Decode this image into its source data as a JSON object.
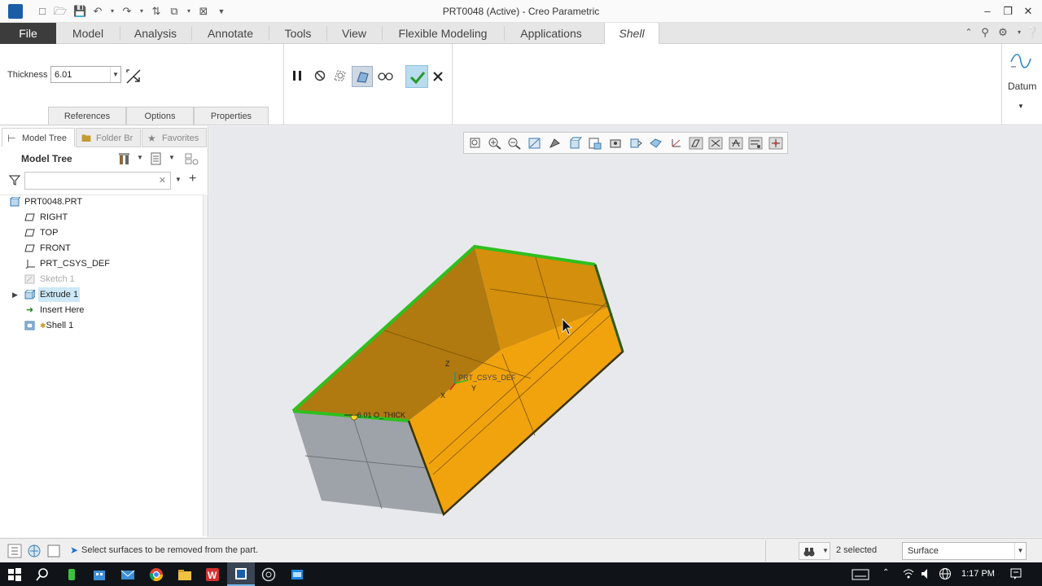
{
  "window": {
    "title": "PRT0048 (Active) - Creo Parametric"
  },
  "ribbon_tabs": [
    "File",
    "Model",
    "Analysis",
    "Annotate",
    "Tools",
    "View",
    "Flexible Modeling",
    "Applications",
    "Shell"
  ],
  "shell_dashboard": {
    "thickness_label": "Thickness",
    "thickness_value": "6.01",
    "subtabs": [
      "References",
      "Options",
      "Properties"
    ],
    "datum_label": "Datum"
  },
  "panel_tabs": [
    "Model Tree",
    "Folder Br",
    "Favorites"
  ],
  "model_tree": {
    "header": "Model Tree",
    "search_placeholder": "",
    "items": [
      {
        "label": "PRT0048.PRT",
        "icon": "part-icon"
      },
      {
        "label": "RIGHT",
        "icon": "datum-plane-icon"
      },
      {
        "label": "TOP",
        "icon": "datum-plane-icon"
      },
      {
        "label": "FRONT",
        "icon": "datum-plane-icon"
      },
      {
        "label": "PRT_CSYS_DEF",
        "icon": "coordinate-system-icon"
      },
      {
        "label": "Sketch 1",
        "icon": "sketch-icon"
      },
      {
        "label": "Extrude 1",
        "icon": "extrude-icon"
      },
      {
        "label": "Insert Here",
        "icon": "insert-arrow-icon"
      },
      {
        "label": "Shell 1",
        "icon": "shell-icon"
      }
    ]
  },
  "viewport": {
    "csys_label": "PRT_CSYS_DEF",
    "thickness_dim_label": "6.01 O_THICK",
    "axis_x": "X",
    "axis_y": "Y",
    "axis_z": "Z",
    "colors": {
      "background": "#e7e9ec",
      "inner_surface": "#f2a40d",
      "inner_shade": "#b07a10",
      "outer_surface": "#9ea3aa",
      "edge_highlight": "#2fbf1f"
    }
  },
  "status": {
    "message": "Select surfaces to be removed from the part.",
    "selected_count": "2 selected",
    "filter_value": "Surface"
  },
  "taskbar": {
    "time": "1:17 PM"
  }
}
